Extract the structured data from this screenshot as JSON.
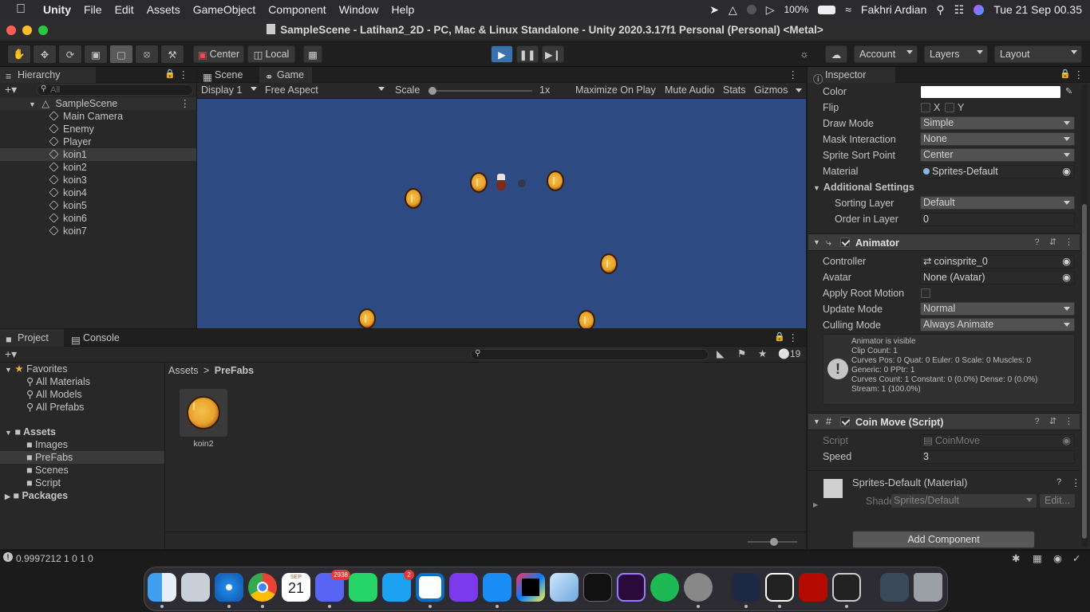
{
  "menubar": {
    "items": [
      "Unity",
      "File",
      "Edit",
      "Assets",
      "GameObject",
      "Component",
      "Window",
      "Help"
    ],
    "battery": "100%",
    "user": "Fakhri Ardian",
    "datetime": "Tue 21 Sep  00.35"
  },
  "window": {
    "title": "SampleScene - Latihan2_2D - PC, Mac & Linux Standalone - Unity 2020.3.17f1 Personal (Personal) <Metal>"
  },
  "toolbar": {
    "pivot": "Center",
    "space": "Local",
    "account": "Account",
    "layers": "Layers",
    "layout": "Layout"
  },
  "hierarchy": {
    "tab": "Hierarchy",
    "search_placeholder": "All",
    "scene": "SampleScene",
    "objects": [
      "Main Camera",
      "Enemy",
      "Player",
      "koin1",
      "koin2",
      "koin3",
      "koin4",
      "koin5",
      "koin6",
      "koin7"
    ]
  },
  "game_view": {
    "tabs": [
      "Scene",
      "Game"
    ],
    "display": "Display 1",
    "aspect": "Free Aspect",
    "scale_label": "Scale",
    "scale_value": "1x",
    "scale_level": 0.0,
    "toggles": [
      "Maximize On Play",
      "Mute Audio",
      "Stats",
      "Gizmos"
    ],
    "background": "#2d4b82"
  },
  "project": {
    "tabs": [
      "Project",
      "Console"
    ],
    "favorites_label": "Favorites",
    "favorites": [
      "All Materials",
      "All Models",
      "All Prefabs"
    ],
    "assets_label": "Assets",
    "asset_folders": [
      "Images",
      "PreFabs",
      "Scenes",
      "Script"
    ],
    "packages_label": "Packages",
    "breadcrumb": [
      "Assets",
      "PreFabs"
    ],
    "files": [
      {
        "name": "koin2"
      }
    ],
    "hidden_count": "19"
  },
  "inspector": {
    "tab": "Inspector",
    "sprite_renderer": {
      "color_label": "Color",
      "flip_label": "Flip",
      "flip_x": "X",
      "flip_y": "Y",
      "draw_mode_label": "Draw Mode",
      "draw_mode": "Simple",
      "mask_label": "Mask Interaction",
      "mask": "None",
      "sort_point_label": "Sprite Sort Point",
      "sort_point": "Center",
      "material_label": "Material",
      "material": "Sprites-Default",
      "additional_label": "Additional Settings",
      "sorting_layer_label": "Sorting Layer",
      "sorting_layer": "Default",
      "order_label": "Order in Layer",
      "order": "0"
    },
    "animator": {
      "title": "Animator",
      "controller_label": "Controller",
      "controller": "coinsprite_0",
      "avatar_label": "Avatar",
      "avatar": "None (Avatar)",
      "root_motion_label": "Apply Root Motion",
      "update_mode_label": "Update Mode",
      "update_mode": "Normal",
      "culling_label": "Culling Mode",
      "culling": "Always Animate",
      "info": [
        "Animator is visible",
        "Clip Count: 1",
        "Curves Pos: 0 Quat: 0 Euler: 0 Scale: 0 Muscles: 0",
        "Generic: 0 PPtr: 1",
        "Curves Count: 1 Constant: 0 (0.0%) Dense: 0 (0.0%)",
        "Stream: 1 (100.0%)"
      ]
    },
    "coin_move": {
      "title": "Coin Move (Script)",
      "script_label": "Script",
      "script": "CoinMove",
      "speed_label": "Speed",
      "speed": "3"
    },
    "material": {
      "title": "Sprites-Default (Material)",
      "shader_label": "Shader",
      "shader": "Sprites/Default",
      "edit": "Edit..."
    },
    "add_component": "Add Component"
  },
  "status_bar": {
    "text": "0.9997212 1 0 1 0"
  },
  "dock": {
    "calendar_month": "SEP",
    "calendar_day": "21",
    "discord_badge": "2938",
    "twitter_badge": "2"
  }
}
